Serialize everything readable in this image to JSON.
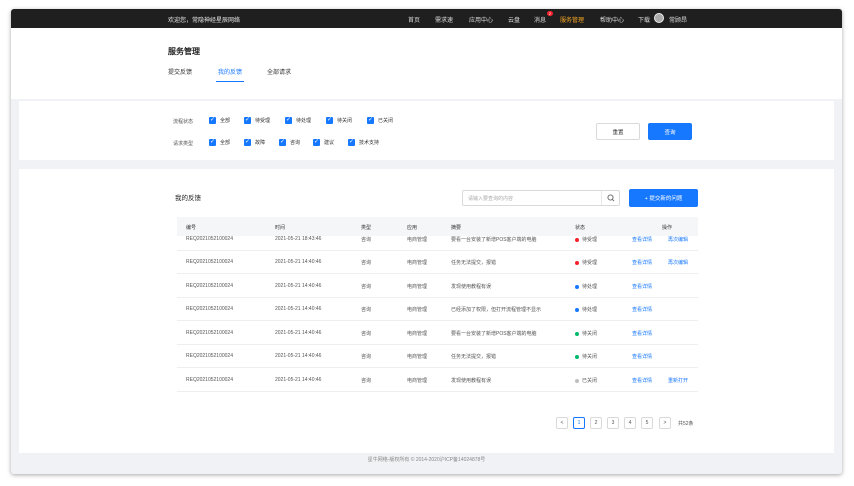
{
  "topbar": {
    "welcome": "欢迎您，常隐神经星辰网络",
    "nav": [
      "首页",
      "需求速",
      "应用中心",
      "云盘",
      "消息",
      "服务管理",
      "帮助中心",
      "下载"
    ],
    "badge": "2",
    "active_index": 5,
    "user": "常顾昂"
  },
  "page": {
    "title": "服务管理"
  },
  "tabs": [
    "提交反馈",
    "我的反馈",
    "全部请求"
  ],
  "filter": {
    "status_label": "流程状态",
    "status_options": [
      "全部",
      "待受理",
      "待处理",
      "待关闭",
      "已关闭"
    ],
    "type_label": "请求类型",
    "type_options": [
      "全部",
      "故障",
      "咨询",
      "建议",
      "技术支持"
    ],
    "reset": "重置",
    "query": "查询"
  },
  "list": {
    "title": "我的反馈",
    "search_placeholder": "请输入要查询的内容",
    "new_button": "+ 提交新的问题",
    "columns": [
      "编号",
      "时间",
      "类型",
      "应用",
      "摘要",
      "状态",
      "操作"
    ],
    "rows": [
      {
        "id": "REQ2021052100024",
        "time": "2021-05-21 18:43:46",
        "type": "咨询",
        "app": "电商管理",
        "summary": "要看一台安装了新增POS客户端的电脑",
        "status": "待受理",
        "status_color": "#f5222d",
        "op1": "查看详情",
        "op2": "再次编辑"
      },
      {
        "id": "REQ2021052100024",
        "time": "2021-05-21 14:40:46",
        "type": "咨询",
        "app": "电商管理",
        "summary": "任务无法提交，报错",
        "status": "待受理",
        "status_color": "#f5222d",
        "op1": "查看详情",
        "op2": "再次编辑"
      },
      {
        "id": "REQ2021052100024",
        "time": "2021-05-21 14:40:46",
        "type": "咨询",
        "app": "电商管理",
        "summary": "发现使用教程有误",
        "status": "待处理",
        "status_color": "#1677ff",
        "op1": "查看详情",
        "op2": ""
      },
      {
        "id": "REQ2021052100024",
        "time": "2021-05-21 14:40:46",
        "type": "咨询",
        "app": "电商管理",
        "summary": "已经添加了权限，但打开流程管理不显示",
        "status": "待处理",
        "status_color": "#1677ff",
        "op1": "查看详情",
        "op2": ""
      },
      {
        "id": "REQ2021052100024",
        "time": "2021-05-21 14:40:46",
        "type": "咨询",
        "app": "电商管理",
        "summary": "要看一台安装了新增POS客户端的电脑",
        "status": "待关闭",
        "status_color": "#00b96b",
        "op1": "查看详情",
        "op2": ""
      },
      {
        "id": "REQ2021052100024",
        "time": "2021-05-21 14:40:46",
        "type": "咨询",
        "app": "电商管理",
        "summary": "任务无法提交，报错",
        "status": "待关闭",
        "status_color": "#00b96b",
        "op1": "查看详情",
        "op2": ""
      },
      {
        "id": "REQ2021052100024",
        "time": "2021-05-21 14:40:46",
        "type": "咨询",
        "app": "电商管理",
        "summary": "发现使用教程有误",
        "status": "已关闭",
        "status_color": "#bfbfbf",
        "op1": "查看详情",
        "op2": "重新打开"
      }
    ]
  },
  "pagination": {
    "prev": "<",
    "pages": [
      "1",
      "2",
      "3",
      "4",
      "5"
    ],
    "next": ">",
    "total": "共52条"
  },
  "footer": "星牛网络-版权所有 © 2014-2020沪ICP备14024878号"
}
